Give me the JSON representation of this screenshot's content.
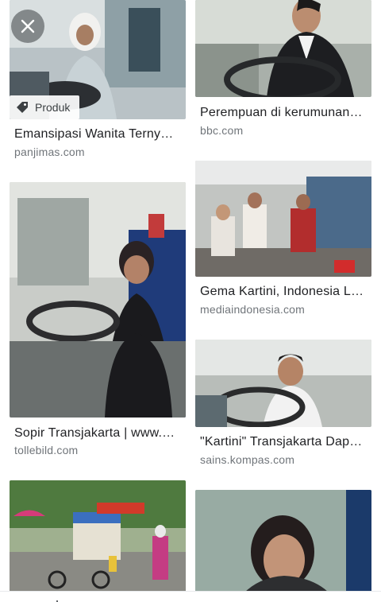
{
  "overlay": {
    "close_icon": "close-icon",
    "badge_label": "Produk",
    "badge_icon": "tag-icon"
  },
  "results": [
    {
      "title": "Emansipasi Wanita Terny…",
      "source": "panjimas.com"
    },
    {
      "title": "Perempuan di kerumunan…",
      "source": "bbc.com"
    },
    {
      "title": "Sopir Transjakarta | www.…",
      "source": "tollebild.com"
    },
    {
      "title": "Gema Kartini, Indonesia L…",
      "source": "mediaindonesia.com"
    },
    {
      "title": "\"Kartini\" Transjakarta Dap…",
      "source": "sains.kompas.com"
    }
  ],
  "bottom_nav": {
    "items": [
      "home-icon",
      "discover-icon",
      "collections-icon"
    ]
  }
}
